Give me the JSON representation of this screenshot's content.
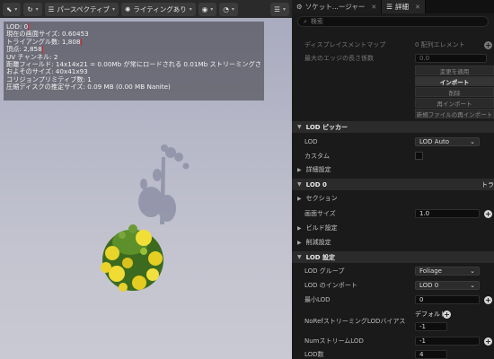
{
  "toolbar": {
    "perspective": "パースペクティブ",
    "lighting": "ライティングあり"
  },
  "stats": {
    "lod": "LOD: 0",
    "screen_size": "現在の画面サイズ: 0.60453",
    "triangles": "トライアングル数: 1,808",
    "vertices": "頂点: 2,858",
    "uv": "UV チャンネル: 2",
    "distance_field": "距離フィールド: 14x14x21 = 0.00Mb が常にロードされる 0.01Mb ストリーミングされる",
    "approx_size": "およそのサイズ: 40x41x93",
    "collision": "コリジョンプリミティブ数: 1",
    "disk_size": "圧縮ディスクの推定サイズ: 0.09 MB (0.00 MB Nanite)"
  },
  "tabs": {
    "socket": "ソケット...ージャー",
    "details": "詳細"
  },
  "search": {
    "placeholder": "検索"
  },
  "details": {
    "displacement_map_label": "ディスプレイスメントマップ",
    "displacement_map_value": "0 配列エレメント",
    "max_edge_label": "最大のエッジの長さ係数",
    "max_edge_value": "0.0",
    "btn_apply": "変更を適用",
    "btn_import": "インポート",
    "btn_delete": "削除",
    "btn_reimport": "再インポート",
    "btn_reimport_new": "新規ファイルの再インポート",
    "lod_picker_header": "LOD ピッカー",
    "lod_label": "LOD",
    "lod_value": "LOD Auto",
    "custom_label": "カスタム",
    "detail_settings": "詳細設定",
    "lod0_header": "LOD 0",
    "lod0_right": "トラ",
    "sections": "セクション",
    "screen_size_label": "画面サイズ",
    "screen_size_value": "1.0",
    "build_settings": "ビルド設定",
    "reduction_settings": "削減設定",
    "lod_settings_header": "LOD 設定",
    "lod_group_label": "LOD グループ",
    "lod_group_value": "Foliage",
    "lod_import_label": "LOD のインポート",
    "lod_import_value": "LOD 0",
    "min_lod_label": "最小LOD",
    "min_lod_value": "0",
    "nore_label": "NoRefストリーミングLODバイアス",
    "default_label": "デフォルト",
    "nore_value": "-1",
    "num_stream_label": "NumストリームLOD",
    "num_stream_value": "-1",
    "lod_count_label": "LOD数",
    "lod_count_value": "4"
  }
}
